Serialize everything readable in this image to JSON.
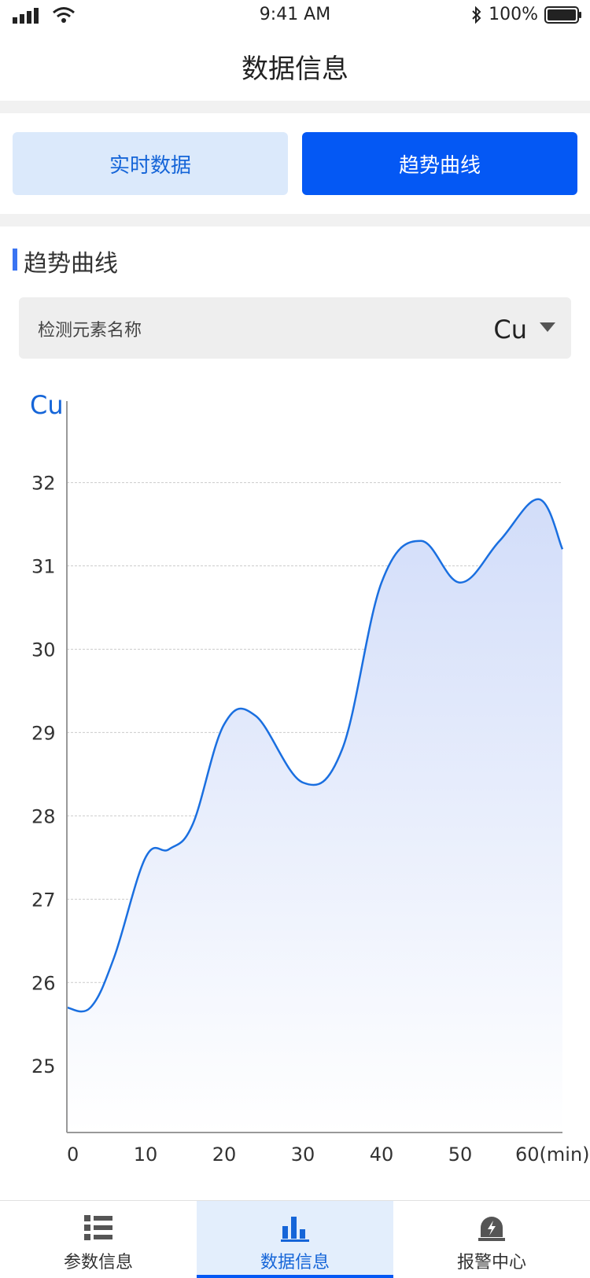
{
  "status": {
    "time": "9:41 AM",
    "battery": "100%"
  },
  "nav": {
    "title": "数据信息"
  },
  "tabs": {
    "realtime": "实时数据",
    "trend": "趋势曲线"
  },
  "section": {
    "title": "趋势曲线"
  },
  "selector": {
    "label": "检测元素名称",
    "value": "Cu"
  },
  "chart_data": {
    "type": "area",
    "title": "Cu",
    "xlabel": "(min)",
    "ylabel": "",
    "x": [
      0,
      3,
      6,
      10,
      13,
      16,
      20,
      24,
      30,
      35,
      40,
      45,
      50,
      55,
      60,
      63
    ],
    "values": [
      25.7,
      25.7,
      26.3,
      27.5,
      27.6,
      27.9,
      29.1,
      29.2,
      28.4,
      28.8,
      30.8,
      31.3,
      30.8,
      31.3,
      31.8,
      31.2
    ],
    "xlim": [
      0,
      63
    ],
    "ylim": [
      24.2,
      32.6
    ],
    "xticks": [
      0,
      10,
      20,
      30,
      40,
      50,
      60
    ],
    "xtick_labels": [
      "0",
      "10",
      "20",
      "30",
      "40",
      "50",
      "60(min)"
    ],
    "yticks": [
      25,
      26,
      27,
      28,
      29,
      30,
      31,
      32
    ],
    "ytick_labels": [
      "25",
      "26",
      "27",
      "28",
      "29",
      "30",
      "31",
      "32"
    ],
    "grid": true,
    "line_color": "#1a6fe0",
    "fill_top_color": "#d2ddf9",
    "fill_bottom_color": "#ffffff"
  },
  "bottom_tabs": [
    {
      "label": "参数信息",
      "icon": "list-icon"
    },
    {
      "label": "数据信息",
      "icon": "bar-chart-icon"
    },
    {
      "label": "报警中心",
      "icon": "alarm-icon"
    }
  ],
  "colors": {
    "primary": "#0458f4",
    "segment_inactive_bg": "#dbe9fb",
    "accent_text": "#1565d8"
  }
}
